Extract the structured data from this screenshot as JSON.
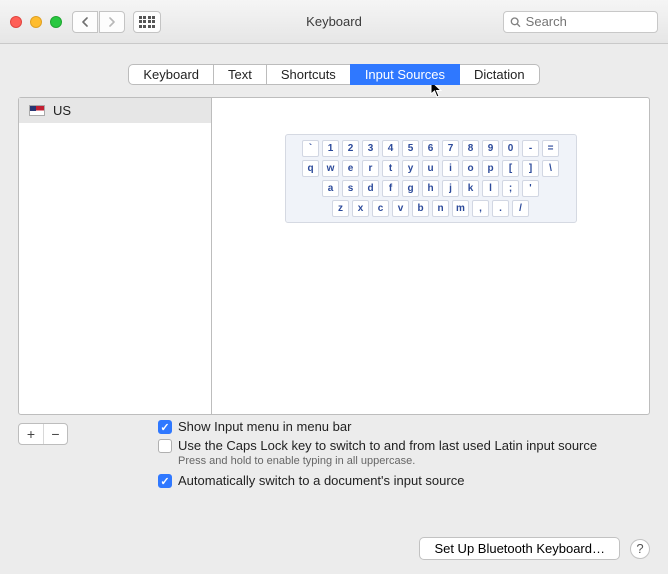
{
  "window": {
    "title": "Keyboard"
  },
  "search": {
    "placeholder": "Search"
  },
  "tabs": [
    {
      "label": "Keyboard",
      "active": false
    },
    {
      "label": "Text",
      "active": false
    },
    {
      "label": "Shortcuts",
      "active": false
    },
    {
      "label": "Input Sources",
      "active": true
    },
    {
      "label": "Dictation",
      "active": false
    }
  ],
  "sources": [
    {
      "name": "US",
      "flag": "us"
    }
  ],
  "keyboard_rows": [
    [
      "`",
      "1",
      "2",
      "3",
      "4",
      "5",
      "6",
      "7",
      "8",
      "9",
      "0",
      "-",
      "="
    ],
    [
      "q",
      "w",
      "e",
      "r",
      "t",
      "y",
      "u",
      "i",
      "o",
      "p",
      "[",
      "]",
      "\\"
    ],
    [
      "a",
      "s",
      "d",
      "f",
      "g",
      "h",
      "j",
      "k",
      "l",
      ";",
      "'"
    ],
    [
      "z",
      "x",
      "c",
      "v",
      "b",
      "n",
      "m",
      ",",
      ".",
      "/"
    ]
  ],
  "add_label": "+",
  "remove_label": "−",
  "options": {
    "show_menu": {
      "checked": true,
      "label": "Show Input menu in menu bar"
    },
    "caps_lock": {
      "checked": false,
      "label": "Use the Caps Lock key to switch to and from last used Latin input source",
      "hint": "Press and hold to enable typing in all uppercase."
    },
    "auto_switch": {
      "checked": true,
      "label": "Automatically switch to a document's input source"
    }
  },
  "footer": {
    "bluetooth": "Set Up Bluetooth Keyboard…",
    "help": "?"
  }
}
